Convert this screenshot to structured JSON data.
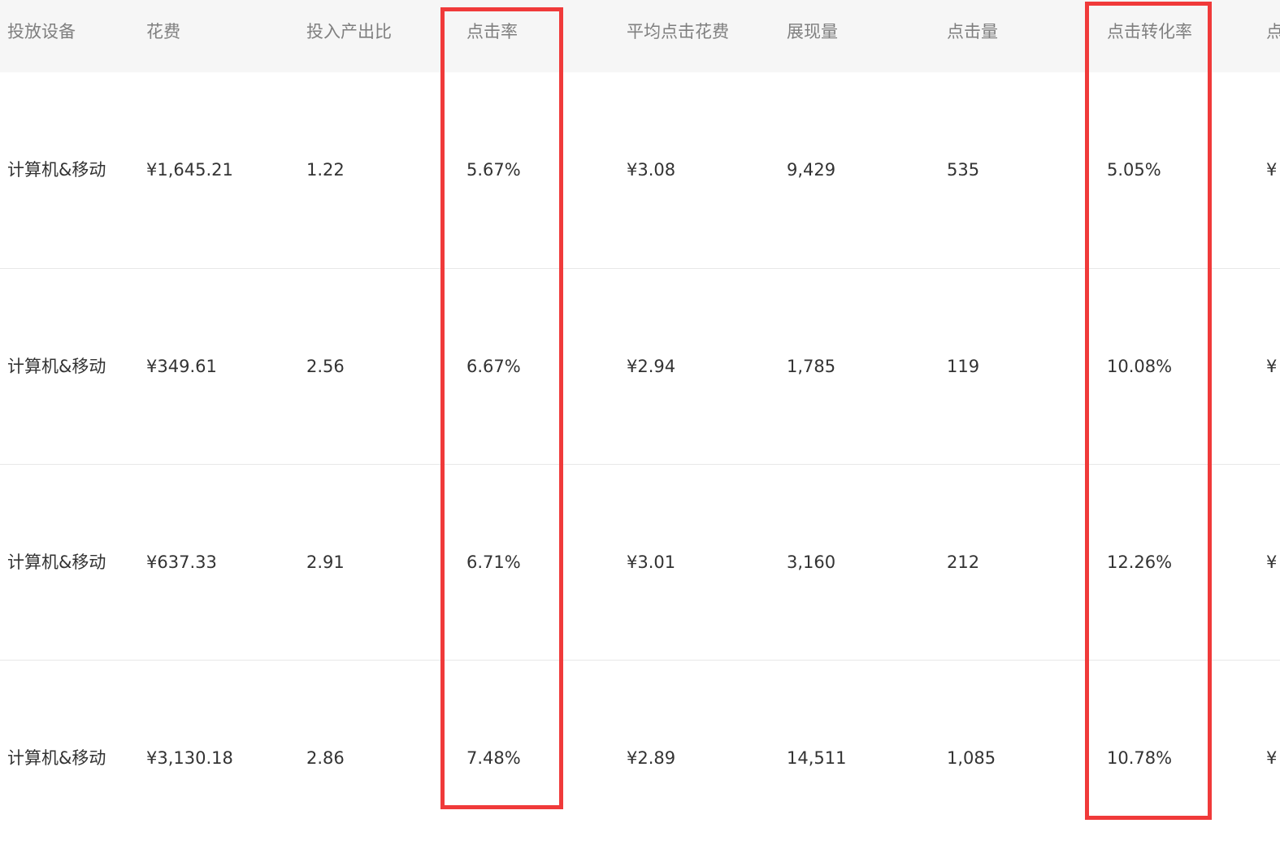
{
  "table": {
    "columns": [
      "投放设备",
      "花费",
      "投入产出比",
      "点击率",
      "平均点击花费",
      "展现量",
      "点击量",
      "点击转化率",
      "点"
    ],
    "rows": [
      [
        "计算机&移动",
        "¥1,645.21",
        "1.22",
        "5.67%",
        "¥3.08",
        "9,429",
        "535",
        "5.05%",
        "¥"
      ],
      [
        "计算机&移动",
        "¥349.61",
        "2.56",
        "6.67%",
        "¥2.94",
        "1,785",
        "119",
        "10.08%",
        "¥"
      ],
      [
        "计算机&移动",
        "¥637.33",
        "2.91",
        "6.71%",
        "¥3.01",
        "3,160",
        "212",
        "12.26%",
        "¥"
      ],
      [
        "计算机&移动",
        "¥3,130.18",
        "2.86",
        "7.48%",
        "¥2.89",
        "14,511",
        "1,085",
        "10.78%",
        "¥"
      ]
    ]
  },
  "colors": {
    "header_bg": "#f6f6f6",
    "header_text": "#7f7f7f",
    "body_text": "#333333",
    "row_divider": "#e8e8e8",
    "highlight_border": "#f03a3a"
  },
  "highlights": [
    "点击率",
    "点击转化率"
  ]
}
